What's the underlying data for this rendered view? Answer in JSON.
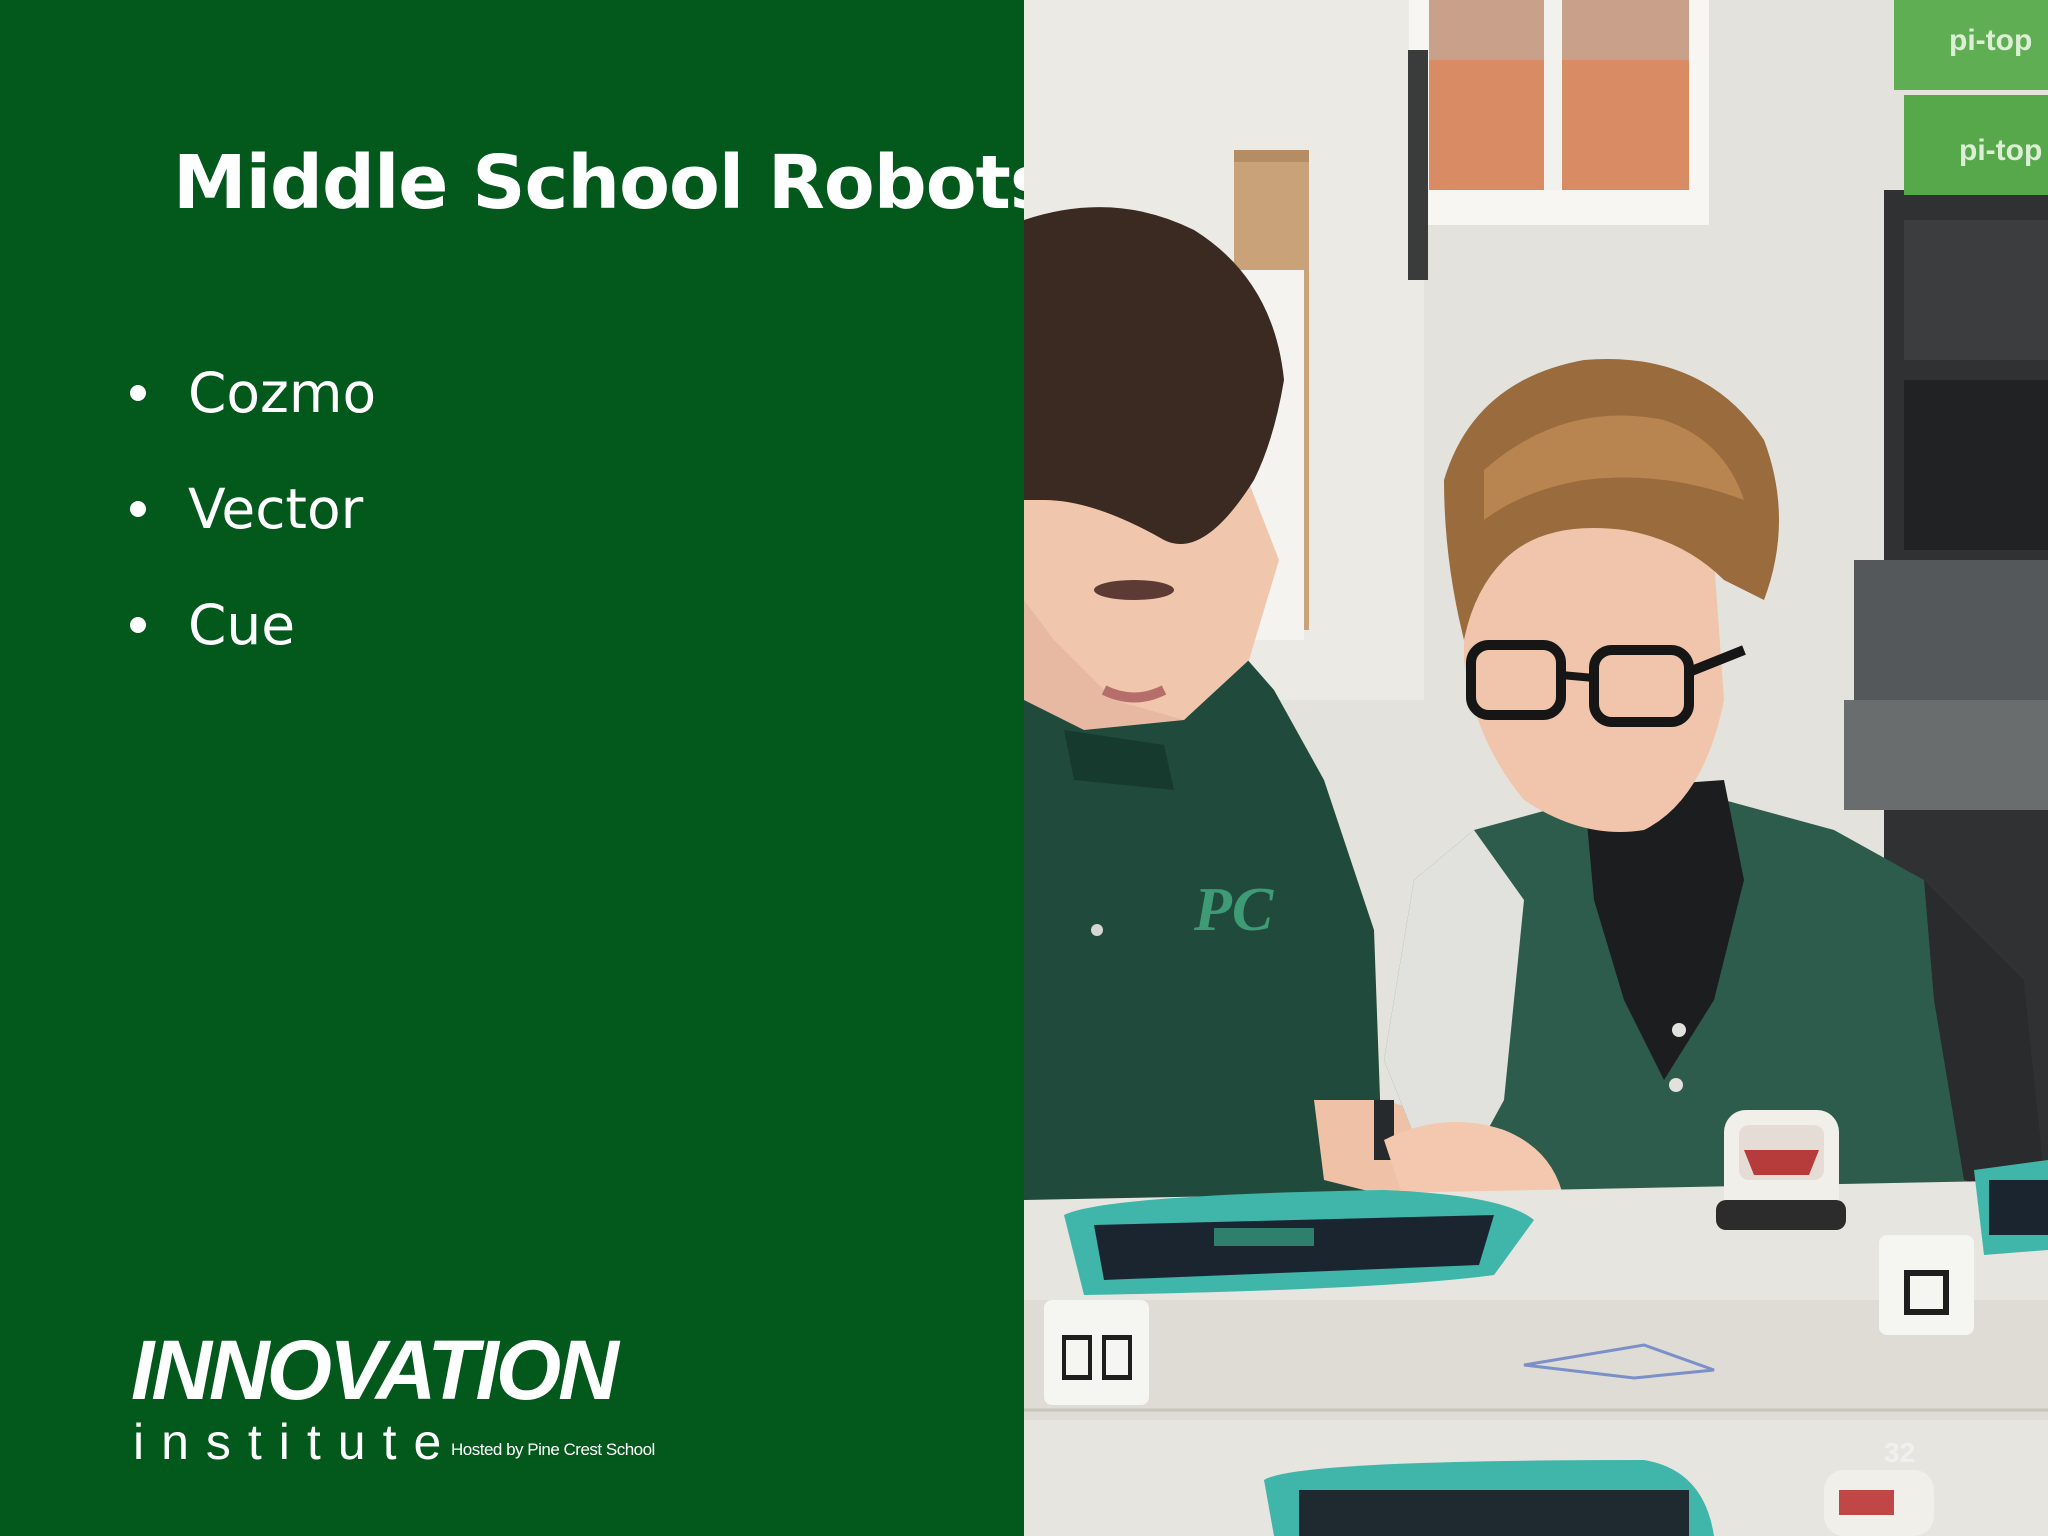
{
  "slide": {
    "title": "Middle School Robots",
    "bullets": [
      "Cozmo",
      "Vector",
      "Cue"
    ],
    "page_number": "32"
  },
  "logo": {
    "main": "INNOVATION",
    "sub": "institute",
    "hosted_by": "Hosted by Pine Crest School"
  },
  "photo": {
    "shirt_monogram": "PC",
    "box_labels": [
      "pi-top",
      "pi-top"
    ]
  },
  "colors": {
    "panel_green": "#03581c",
    "text_white": "#ffffff"
  }
}
